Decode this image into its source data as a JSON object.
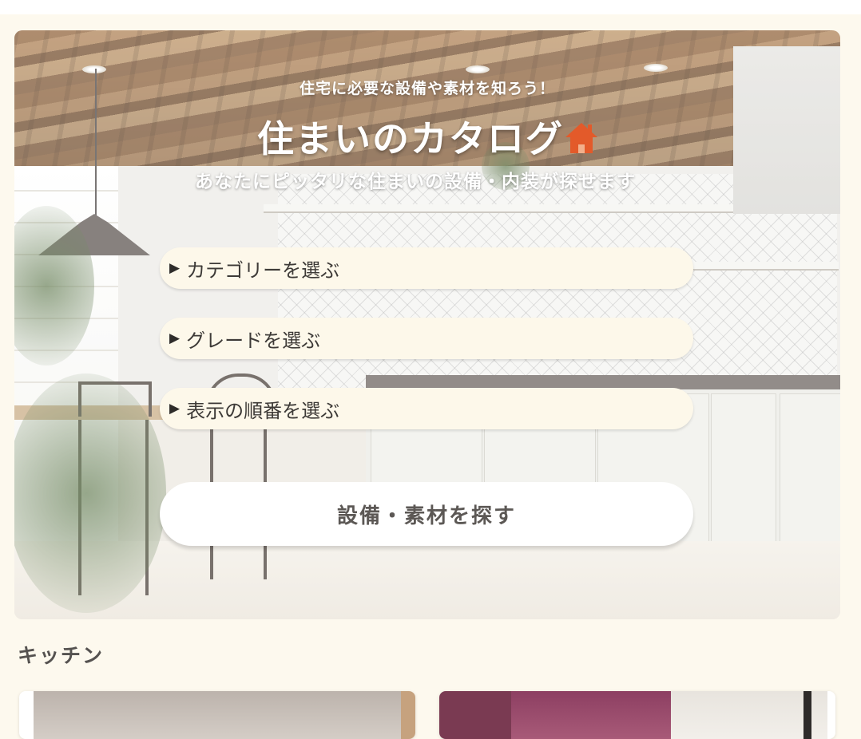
{
  "hero": {
    "subtitle": "住宅に必要な設備や素材を知ろう！",
    "title": "住まいのカタログ",
    "title_icon": "house-icon",
    "description": "あなたにピッタリな住まいの設備・内装が探せます",
    "background": "kitchen-interior-photo"
  },
  "filters": [
    {
      "label": "カテゴリーを選ぶ",
      "icon": "triangle-right-icon"
    },
    {
      "label": "グレードを選ぶ",
      "icon": "triangle-right-icon"
    },
    {
      "label": "表示の順番を選ぶ",
      "icon": "triangle-right-icon"
    }
  ],
  "search_button": {
    "label": "設備・素材を探す"
  },
  "section": {
    "heading": "キッチン"
  },
  "colors": {
    "page_background": "#fdf9ee",
    "accent_house": "#e35a2a",
    "pill_background": "#fdf8ea",
    "button_background": "#ffffff",
    "heading_text": "#555250"
  }
}
